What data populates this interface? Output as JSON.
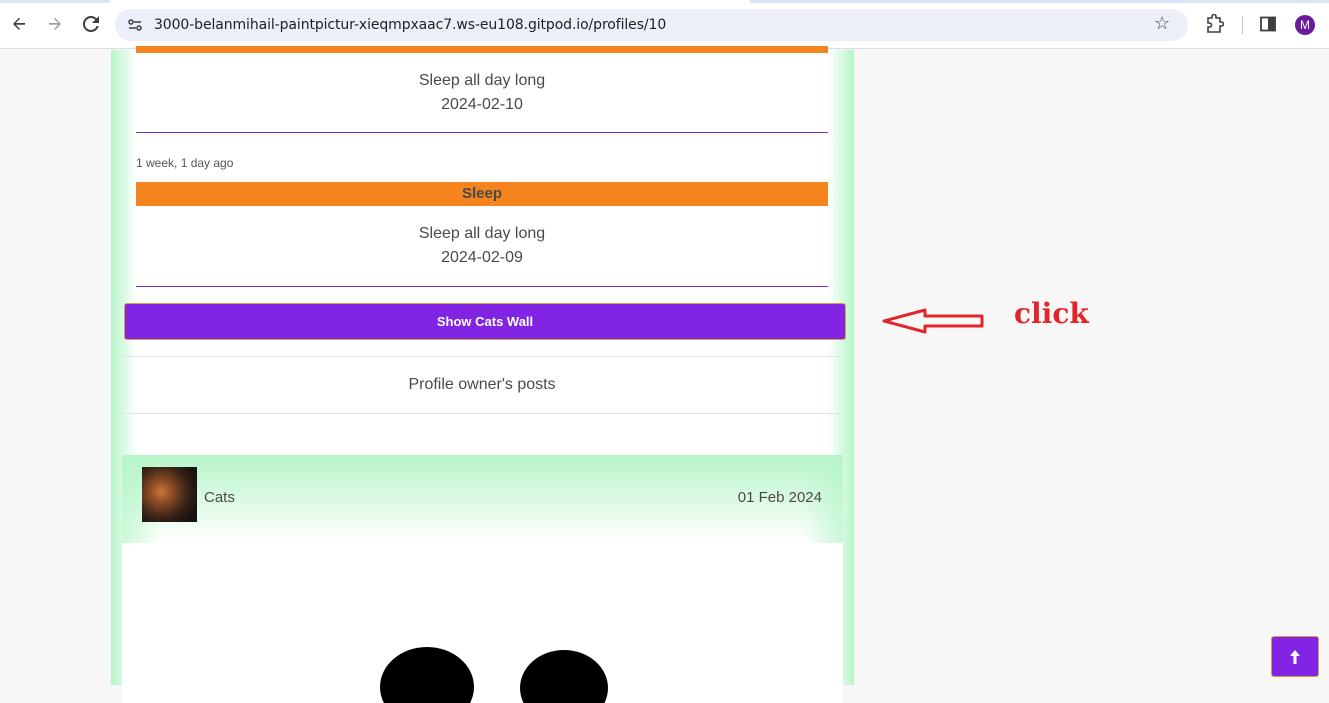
{
  "browser": {
    "url": "3000-belanmihail-paintpictur-xieqmpxaac7.ws-eu108.gitpod.io/profiles/10",
    "avatar_letter": "M",
    "icons": [
      "back-arrow-icon",
      "forward-arrow-icon",
      "reload-icon",
      "site-info-icon",
      "bookmark-star-icon",
      "extensions-icon",
      "side-panel-icon"
    ]
  },
  "feed": {
    "entry1": {
      "description": "Sleep all day long",
      "date": "2024-02-10"
    },
    "entry2": {
      "timeago": "1 week, 1 day ago",
      "category": "Sleep",
      "description": "Sleep all day long",
      "date": "2024-02-09"
    }
  },
  "wall_button_label": "Show Cats Wall",
  "posts_heading": "Profile owner's posts",
  "post": {
    "author": "Cats",
    "date": "01 Feb 2024"
  },
  "annotation": {
    "text": "click",
    "color": "#e0262a"
  },
  "colors": {
    "accent_purple": "#8224e3",
    "category_orange": "#f5841f",
    "column_glow": "#b6f5c8"
  }
}
